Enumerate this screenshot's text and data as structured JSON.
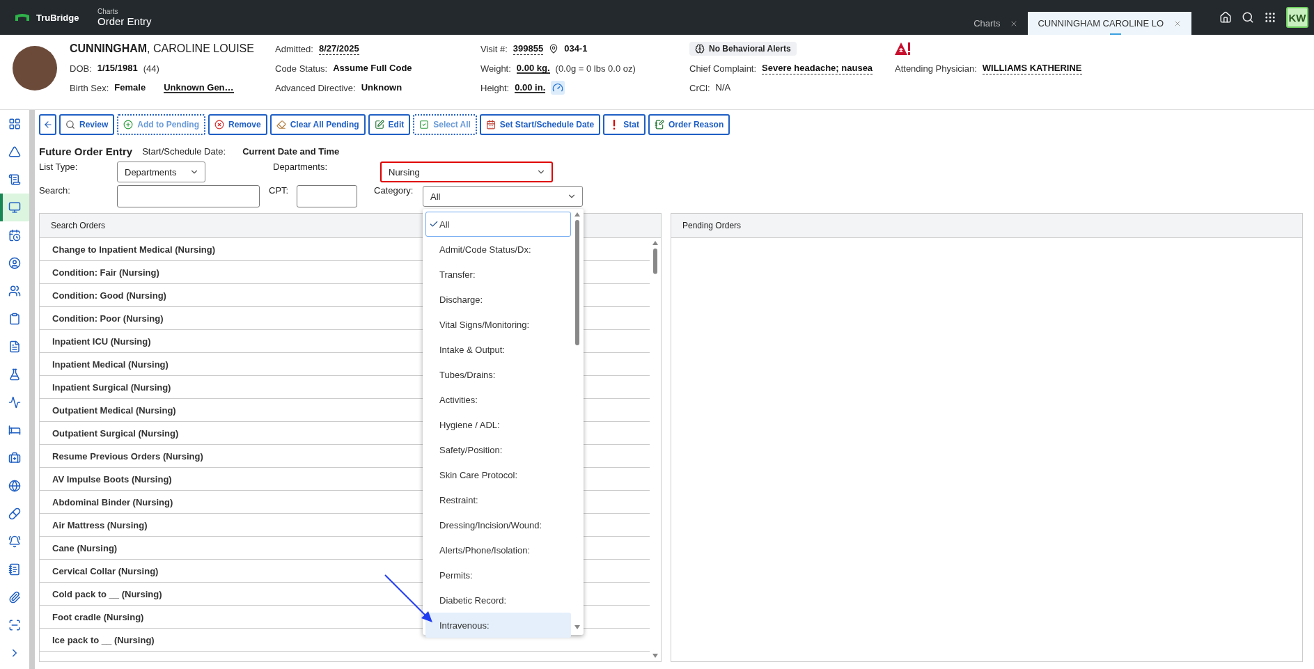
{
  "top_bar": {
    "brand": "TruBridge",
    "breadcrumb": "Charts",
    "page_title": "Order Entry",
    "user_initials": "KW",
    "tabs": [
      {
        "label": "Charts",
        "selected": false
      },
      {
        "label": "CUNNINGHAM CAROLINE LO",
        "selected": true
      }
    ]
  },
  "patient": {
    "columns": [
      [
        {
          "kind": "name",
          "text": "**CUNNINGHAM**, CAROLINE LOUISE"
        },
        {
          "kind": "field",
          "label": "DOB:",
          "values": [
            {
              "text": "1/15/1981",
              "link": false,
              "underlined": false,
              "bold": true
            }
          ],
          "note": "(44)"
        },
        {
          "kind": "field",
          "label": "Birth Sex:",
          "values": [
            {
              "text": "Female",
              "link": false,
              "underlined": false,
              "bold": true
            },
            {
              "text": "Unknown Gen…",
              "link": false,
              "underlined": true,
              "bold": true
            }
          ]
        }
      ],
      [
        {
          "kind": "field",
          "label": "Admitted:",
          "values": [
            {
              "text": "8/27/2025",
              "link": true,
              "underlined": false,
              "bold": true
            }
          ]
        },
        {
          "kind": "field",
          "label": "Code Status:",
          "values": [
            {
              "text": "Assume Full Code",
              "link": false,
              "underlined": false,
              "bold": true
            }
          ]
        },
        {
          "kind": "field",
          "label": "Advanced Directive:",
          "values": [
            {
              "text": "Unknown",
              "link": false,
              "underlined": false,
              "bold": true
            }
          ]
        }
      ],
      [
        {
          "kind": "field",
          "label": "Visit #:",
          "values": [
            {
              "text": "399855",
              "link": true,
              "underlined": false,
              "bold": true
            }
          ],
          "location": "034-1"
        },
        {
          "kind": "field",
          "label": "Weight:",
          "values": [
            {
              "text": "0.00 kg.",
              "link": false,
              "underlined": true,
              "bold": true
            }
          ],
          "note": "(0.0g = 0 lbs 0.0 oz)"
        },
        {
          "kind": "field",
          "label": "Height:",
          "values": [
            {
              "text": "0.00 in.",
              "link": false,
              "underlined": true,
              "bold": true
            }
          ],
          "scale_button": true
        }
      ],
      [
        {
          "kind": "badge",
          "text": "No Behavioral Alerts"
        },
        {
          "kind": "field",
          "label": "Chief Complaint:",
          "values": [
            {
              "text": "Severe headache; nausea",
              "link": true,
              "underlined": false,
              "bold": true
            }
          ]
        },
        {
          "kind": "field",
          "label": "CrCl:",
          "values": [
            {
              "text": "N/A",
              "link": false,
              "underlined": false,
              "bold": false
            }
          ]
        }
      ],
      [
        {
          "kind": "alert_icon"
        },
        {
          "kind": "field",
          "label": "Attending Physician:",
          "values": [
            {
              "text": "WILLIAMS KATHERINE",
              "link": true,
              "underlined": false,
              "bold": true
            }
          ]
        }
      ]
    ]
  },
  "sidebar": {
    "items": [
      {
        "selected": false
      },
      {
        "selected": false
      },
      {
        "selected": false
      },
      {
        "selected": true
      },
      {
        "selected": false
      },
      {
        "selected": false
      },
      {
        "selected": false
      },
      {
        "selected": false
      },
      {
        "selected": false
      },
      {
        "selected": false
      },
      {
        "selected": false
      },
      {
        "selected": false
      },
      {
        "selected": false
      },
      {
        "selected": false
      },
      {
        "selected": false
      },
      {
        "selected": false
      },
      {
        "selected": false
      },
      {
        "selected": false
      },
      {
        "selected": false
      }
    ]
  },
  "toolbar": {
    "buttons": [
      {
        "kind": "icon",
        "disabled": false
      },
      {
        "kind": "text",
        "label": "Review",
        "disabled": false
      },
      {
        "kind": "text",
        "label": "Add to Pending",
        "disabled": true
      },
      {
        "kind": "text",
        "label": "Remove",
        "disabled": false
      },
      {
        "kind": "text",
        "label": "Clear All Pending",
        "disabled": false
      },
      {
        "kind": "text",
        "label": "Edit",
        "disabled": false
      },
      {
        "kind": "text",
        "label": "Select All",
        "disabled": true
      },
      {
        "kind": "text",
        "label": "Set Start/Schedule Date",
        "disabled": false
      },
      {
        "kind": "text",
        "label": "Stat",
        "disabled": false
      },
      {
        "kind": "text",
        "label": "Order Reason",
        "disabled": false
      }
    ]
  },
  "form": {
    "title": "Future Order Entry",
    "start_label": "Start/Schedule Date:",
    "start_value": "Current Date and Time",
    "list_type": {
      "label": "List Type:",
      "value": "Departments"
    },
    "departments": {
      "label": "Departments:",
      "value": "Nursing",
      "error": true
    },
    "search": {
      "label": "Search:"
    },
    "cpt": {
      "label": "CPT:"
    },
    "category": {
      "label": "Category:",
      "value": "All",
      "open": true,
      "options": [
        {
          "label": "All",
          "selected": true,
          "highlighted": false
        },
        {
          "label": "Admit/Code Status/Dx:",
          "selected": false,
          "highlighted": false
        },
        {
          "label": "Transfer:",
          "selected": false,
          "highlighted": false
        },
        {
          "label": "Discharge:",
          "selected": false,
          "highlighted": false
        },
        {
          "label": "Vital Signs/Monitoring:",
          "selected": false,
          "highlighted": false
        },
        {
          "label": "Intake & Output:",
          "selected": false,
          "highlighted": false
        },
        {
          "label": "Tubes/Drains:",
          "selected": false,
          "highlighted": false
        },
        {
          "label": "Activities:",
          "selected": false,
          "highlighted": false
        },
        {
          "label": "Hygiene / ADL:",
          "selected": false,
          "highlighted": false
        },
        {
          "label": "Safety/Position:",
          "selected": false,
          "highlighted": false
        },
        {
          "label": "Skin Care Protocol:",
          "selected": false,
          "highlighted": false
        },
        {
          "label": "Restraint:",
          "selected": false,
          "highlighted": false
        },
        {
          "label": "Dressing/Incision/Wound:",
          "selected": false,
          "highlighted": false
        },
        {
          "label": "Alerts/Phone/Isolation:",
          "selected": false,
          "highlighted": false
        },
        {
          "label": "Permits:",
          "selected": false,
          "highlighted": false
        },
        {
          "label": "Diabetic Record:",
          "selected": false,
          "highlighted": false
        },
        {
          "label": "Intravenous:",
          "selected": false,
          "highlighted": true
        }
      ]
    },
    "annotation_arrow": true
  },
  "search_orders": {
    "title": "Search Orders",
    "rows": [
      "Change to Inpatient Medical (Nursing)",
      "Condition: Fair (Nursing)",
      "Condition: Good (Nursing)",
      "Condition: Poor (Nursing)",
      "Inpatient ICU (Nursing)",
      "Inpatient Medical (Nursing)",
      "Inpatient Surgical (Nursing)",
      "Outpatient Medical (Nursing)",
      "Outpatient Surgical (Nursing)",
      "Resume Previous Orders (Nursing)",
      "AV Impulse Boots (Nursing)",
      "Abdominal Binder (Nursing)",
      "Air Mattress (Nursing)",
      "Cane (Nursing)",
      "Cervical Collar (Nursing)",
      "Cold pack to __ (Nursing)",
      "Foot cradle (Nursing)",
      "Ice pack to __ (Nursing)"
    ]
  },
  "pending_orders": {
    "title": "Pending Orders"
  }
}
